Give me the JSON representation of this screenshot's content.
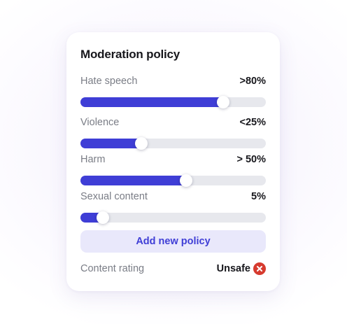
{
  "card": {
    "title": "Moderation policy",
    "policies": [
      {
        "label": "Hate speech",
        "value": ">80%",
        "level": 0.77
      },
      {
        "label": "Violence",
        "value": "<25%",
        "level": 0.33
      },
      {
        "label": "Harm",
        "value": "> 50%",
        "level": 0.57
      },
      {
        "label": "Sexual content",
        "value": "5%",
        "level": 0.12
      }
    ],
    "add_button_label": "Add new policy",
    "rating": {
      "label": "Content rating",
      "value": "Unsafe",
      "icon": "x-circle-icon",
      "status_color": "#d63b2f"
    }
  },
  "colors": {
    "accent": "#3f3ed6",
    "track": "#e7e8ed",
    "button_bg": "#e9e8fb"
  }
}
